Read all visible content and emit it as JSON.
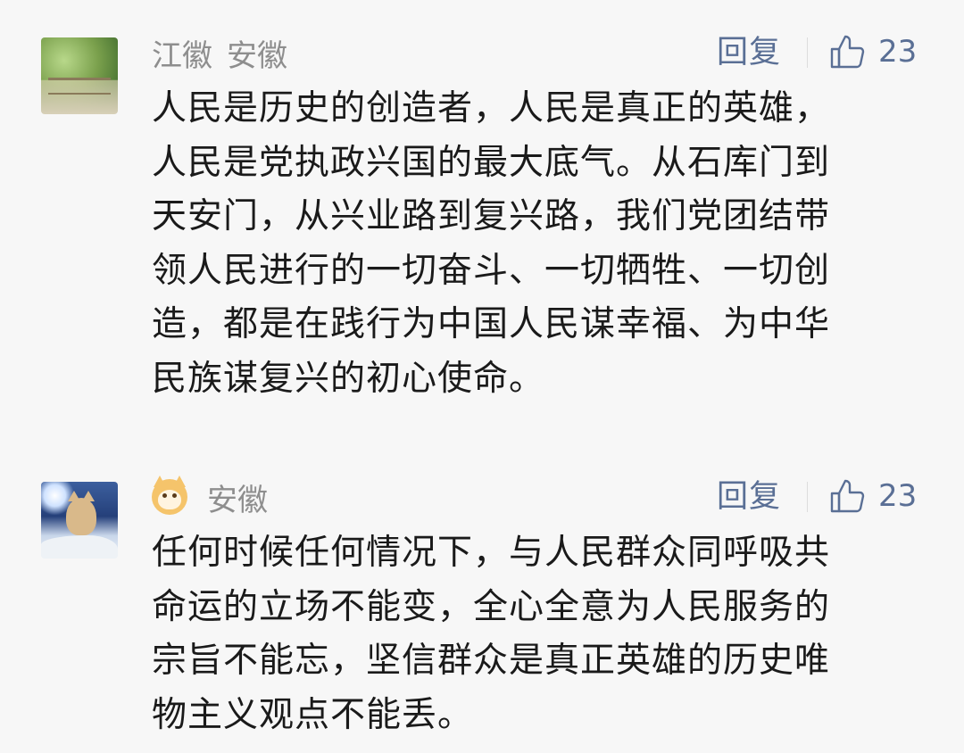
{
  "comments": [
    {
      "nickname": "江徽",
      "location": "安徽",
      "reply_label": "回复",
      "like_count": "23",
      "text": "人民是历史的创造者，人民是真正的英雄，\n人民是党执政兴国的最大底气。从石库门到\n天安门，从兴业路到复兴路，我们党团结带\n领人民进行的一切奋斗、一切牺牲、一切创\n造，都是在践行为中国人民谋幸福、为中华\n民族谋复兴的初心使命。"
    },
    {
      "location": "安徽",
      "reply_label": "回复",
      "like_count": "23",
      "text": "任何时候任何情况下，与人民群众同呼吸共\n命运的立场不能变，全心全意为人民服务的\n宗旨不能忘，坚信群众是真正英雄的历史唯\n物主义观点不能丢。"
    }
  ],
  "colors": {
    "background": "#f7f7f7",
    "meta_text": "#8e8e8e",
    "action": "#5a6f95",
    "body_text": "#1a1a1a"
  },
  "icons": {
    "like": "thumbs-up-outline-icon",
    "nickname_emoji": "shiba-dog-emoji-icon"
  }
}
